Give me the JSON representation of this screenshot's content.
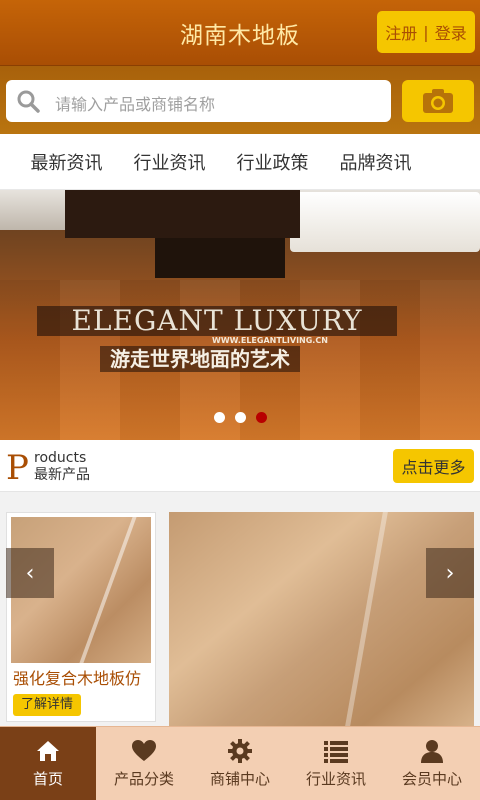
{
  "header": {
    "title": "湖南木地板",
    "register_label": "注册",
    "divider": "|",
    "login_label": "登录"
  },
  "search": {
    "placeholder": "请输入产品或商铺名称",
    "icon": "search-icon",
    "camera_icon": "camera-icon"
  },
  "nav": {
    "items": [
      {
        "label": "最新资讯"
      },
      {
        "label": "行业资讯"
      },
      {
        "label": "行业政策"
      },
      {
        "label": "品牌资讯"
      }
    ]
  },
  "banner": {
    "headline": "ELEGANT LUXURY",
    "url_text": "WWW.ELEGANTLIVING.CN",
    "slogan": "游走世界地面的艺术",
    "dots_total": 3,
    "active_dot": 3
  },
  "products": {
    "big_letter": "P",
    "label_en": "roducts",
    "label_cn": "最新产品",
    "more_label": "点击更多",
    "items": [
      {
        "name": "强化复合木地板仿",
        "detail_label": "了解详情"
      }
    ],
    "prev_icon": "chevron-left-icon",
    "next_icon": "chevron-right-icon"
  },
  "tabbar": {
    "items": [
      {
        "label": "首页",
        "icon": "home-icon",
        "active": true
      },
      {
        "label": "产品分类",
        "icon": "heart-icon",
        "active": false
      },
      {
        "label": "商铺中心",
        "icon": "gear-icon",
        "active": false
      },
      {
        "label": "行业资讯",
        "icon": "list-icon",
        "active": false
      },
      {
        "label": "会员中心",
        "icon": "user-icon",
        "active": false
      }
    ]
  },
  "colors": {
    "brand": "#a94e04",
    "accent": "#f5c600",
    "tabbar_bg": "#f3cfb3",
    "tabbar_active": "#7a4017",
    "active_dot": "#b80000"
  }
}
